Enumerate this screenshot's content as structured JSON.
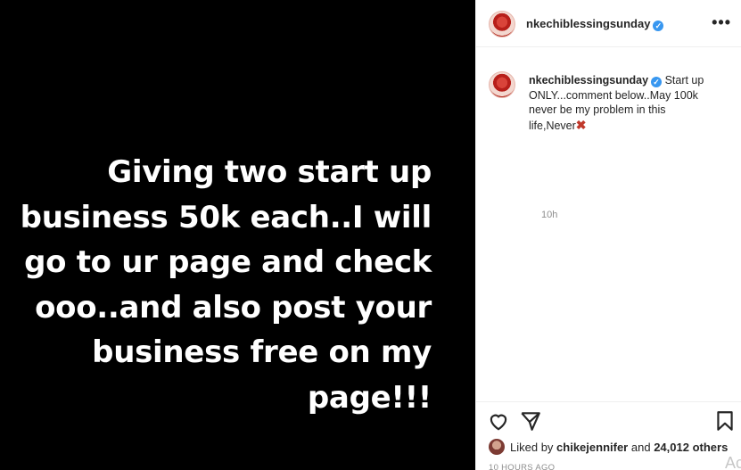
{
  "post": {
    "image_text": "Giving two start up business 50k each..I will go to ur page and check ooo..and also post your business free on my page!!!"
  },
  "header": {
    "username": "nkechiblessingsunday",
    "more_label": "•••"
  },
  "caption": {
    "username": "nkechiblessingsunday",
    "text": "Start up ONLY...comment below..May 100k never be my problem in this life,Never",
    "emoji": "✖",
    "time": "10h"
  },
  "actions": {
    "liked_by_prefix": "Liked by",
    "liked_by_user": "chikejennifer",
    "liked_by_suffix": "and",
    "others_count": "24,012 others",
    "timestamp": "10 HOURS AGO",
    "watermark": "Ac"
  },
  "colors": {
    "verified": "#3897f0",
    "muted_text": "#8e8e8e",
    "text": "#262626"
  }
}
